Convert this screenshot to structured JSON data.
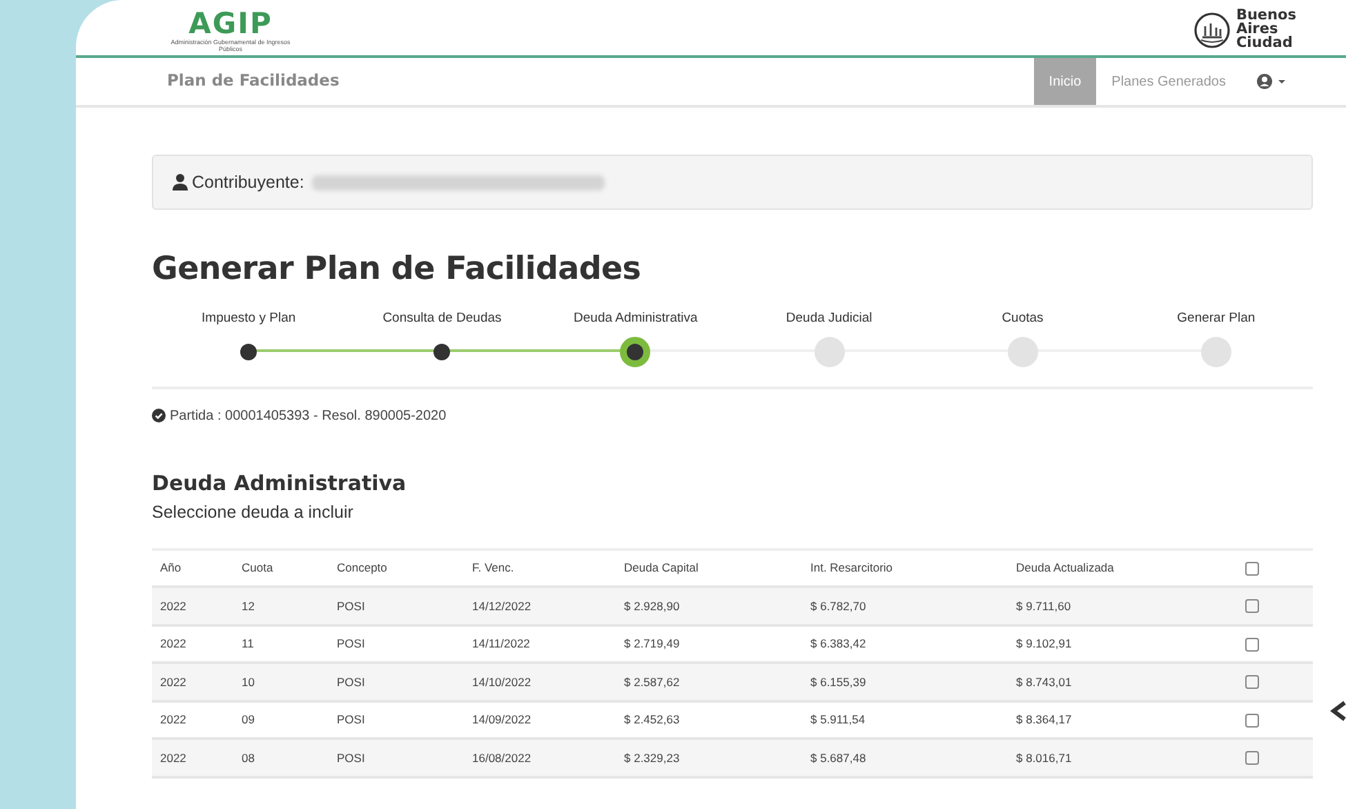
{
  "header": {
    "logo_text": "AGIP",
    "logo_subtitle": "Administración Gubernamental de Ingresos Públicos",
    "city_lines": [
      "Buenos",
      "Aires",
      "Ciudad"
    ]
  },
  "navbar": {
    "brand": "Plan de Facilidades",
    "items": [
      {
        "label": "Inicio",
        "selected": true
      },
      {
        "label": "Planes Generados",
        "selected": false
      }
    ]
  },
  "taxpayer": {
    "label": "Contribuyente:"
  },
  "title": "Generar Plan de Facilidades",
  "steps": [
    {
      "label": "Impuesto y Plan",
      "completed": true,
      "selected": false
    },
    {
      "label": "Consulta de Deudas",
      "completed": true,
      "selected": false
    },
    {
      "label": "Deuda Administrativa",
      "completed": false,
      "selected": true
    },
    {
      "label": "Deuda Judicial",
      "completed": false,
      "selected": false
    },
    {
      "label": "Cuotas",
      "completed": false,
      "selected": false
    },
    {
      "label": "Generar Plan",
      "completed": false,
      "selected": false
    }
  ],
  "partida": "Partida : 00001405393 - Resol. 890005-2020",
  "section": {
    "title": "Deuda Administrativa",
    "subtitle": "Seleccione deuda a incluir"
  },
  "table": {
    "columns": [
      "Año",
      "Cuota",
      "Concepto",
      "F. Venc.",
      "Deuda Capital",
      "Int. Resarcitorio",
      "Deuda Actualizada"
    ],
    "select_all_checked": false,
    "rows": [
      {
        "cells": [
          "2022",
          "12",
          "POSI",
          "14/12/2022",
          "$ 2.928,90",
          "$ 6.782,70",
          "$ 9.711,60"
        ],
        "checked": false
      },
      {
        "cells": [
          "2022",
          "11",
          "POSI",
          "14/11/2022",
          "$ 2.719,49",
          "$ 6.383,42",
          "$ 9.102,91"
        ],
        "checked": false
      },
      {
        "cells": [
          "2022",
          "10",
          "POSI",
          "14/10/2022",
          "$ 2.587,62",
          "$ 6.155,39",
          "$ 8.743,01"
        ],
        "checked": false
      },
      {
        "cells": [
          "2022",
          "09",
          "POSI",
          "14/09/2022",
          "$ 2.452,63",
          "$ 5.911,54",
          "$ 8.364,17"
        ],
        "checked": false
      },
      {
        "cells": [
          "2022",
          "08",
          "POSI",
          "16/08/2022",
          "$ 2.329,23",
          "$ 5.687,48",
          "$ 8.016,71"
        ],
        "checked": false
      }
    ]
  }
}
